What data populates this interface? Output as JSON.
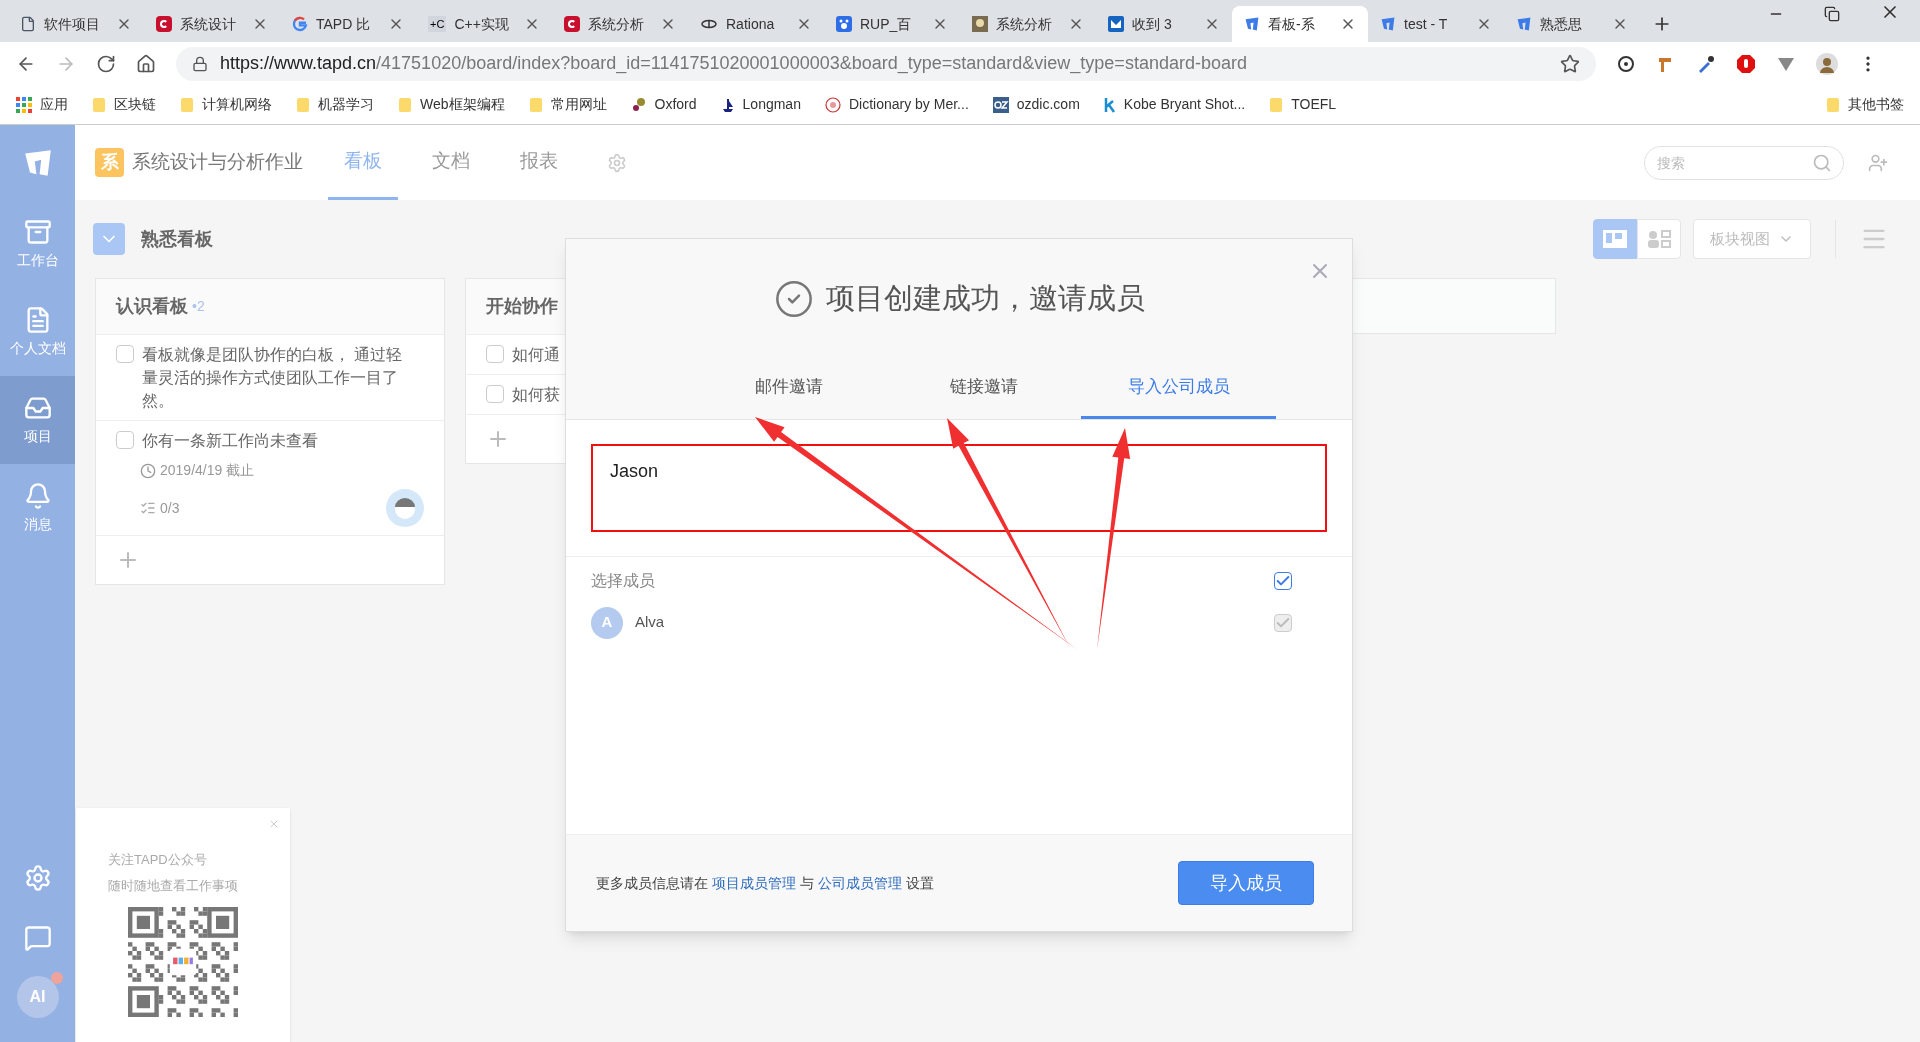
{
  "browser": {
    "tabs": [
      {
        "title": "软件项目",
        "kind": "doc",
        "selected": false
      },
      {
        "title": "系统设计",
        "kind": "red",
        "selected": false
      },
      {
        "title": "TAPD 比",
        "kind": "google",
        "selected": false
      },
      {
        "title": "C++实现",
        "kind": "badge",
        "badge": "+C",
        "selected": false
      },
      {
        "title": "系统分析",
        "kind": "red",
        "selected": false
      },
      {
        "title": "Rationa",
        "kind": "bee",
        "selected": false
      },
      {
        "title": "RUP_百",
        "kind": "paw",
        "selected": false
      },
      {
        "title": "系统分析",
        "kind": "photo",
        "selected": false
      },
      {
        "title": "收到 3",
        "kind": "mail",
        "selected": false
      },
      {
        "title": "看板-系",
        "kind": "tapd",
        "selected": true
      },
      {
        "title": "test - T",
        "kind": "tapd",
        "selected": false
      },
      {
        "title": "熟悉思",
        "kind": "tapd",
        "selected": false
      }
    ],
    "url_host": "https://www.tapd.cn",
    "url_path": "/41751020/board/index?board_id=1141751020001000003&board_type=standard&view_type=standard-board",
    "bookmarks": [
      {
        "label": "应用",
        "kind": "apps"
      },
      {
        "label": "区块链",
        "kind": "folder"
      },
      {
        "label": "计算机网络",
        "kind": "folder"
      },
      {
        "label": "机器学习",
        "kind": "folder"
      },
      {
        "label": "Web框架编程",
        "kind": "folder"
      },
      {
        "label": "常用网址",
        "kind": "folder"
      },
      {
        "label": "Oxford",
        "kind": "dots"
      },
      {
        "label": "Longman",
        "kind": "ship"
      },
      {
        "label": "Dictionary by Mer...",
        "kind": "mw"
      },
      {
        "label": "ozdic.com",
        "kind": "oz"
      },
      {
        "label": "Kobe Bryant Shot...",
        "kind": "k"
      },
      {
        "label": "TOEFL",
        "kind": "folder"
      }
    ],
    "other_bookmarks": "其他书签"
  },
  "sidebar": {
    "items": [
      {
        "label": "工作台",
        "kind": "desk",
        "selected": false
      },
      {
        "label": "个人文档",
        "kind": "doc",
        "selected": false
      },
      {
        "label": "项目",
        "kind": "inbox",
        "selected": true
      },
      {
        "label": "消息",
        "kind": "bell",
        "selected": false
      }
    ],
    "avatar": "AI"
  },
  "header": {
    "project_badge": "系",
    "project_name": "系统设计与分析作业",
    "nav": [
      {
        "label": "看板",
        "selected": true
      },
      {
        "label": "文档",
        "selected": false
      },
      {
        "label": "报表",
        "selected": false
      }
    ],
    "search": {
      "placeholder": "搜索"
    }
  },
  "board": {
    "title": "熟悉看板",
    "views": [
      {
        "kind": "card",
        "selected": true
      },
      {
        "kind": "member",
        "selected": false
      }
    ],
    "view_dropdown": "板块视图",
    "columns": [
      {
        "title": "认识看板",
        "count": "•2",
        "cards": [
          {
            "text": "看板就像是团队协作的白板， 通过轻量灵活的操作方式使团队工作一目了然。",
            "checked": false
          },
          {
            "text": "你有一条新工作尚未查看",
            "checked": false,
            "due": "2019/4/19 截止",
            "subtasks": "0/3"
          }
        ]
      },
      {
        "title": "开始协作",
        "cards": [
          {
            "text": "如何通",
            "checked": false
          },
          {
            "text": "如何获",
            "checked": false
          }
        ]
      }
    ]
  },
  "dialog": {
    "title": "项目创建成功，邀请成员",
    "tabs": [
      {
        "label": "邮件邀请",
        "selected": false
      },
      {
        "label": "链接邀请",
        "selected": false
      },
      {
        "label": "导入公司成员",
        "selected": true
      }
    ],
    "input_value": "Jason",
    "select_label": "选择成员",
    "select_all_checked": true,
    "members": [
      {
        "initial": "A",
        "name": "Alva",
        "checked": true,
        "disabled": true
      }
    ],
    "footer_parts": [
      "更多成员信息请在 ",
      "项目成员管理",
      " 与 ",
      "公司成员管理",
      " 设置"
    ],
    "button": "导入成员"
  },
  "qr_popup": {
    "lines": [
      "关注TAPD公众号",
      "随时随地查看工作事项"
    ]
  }
}
